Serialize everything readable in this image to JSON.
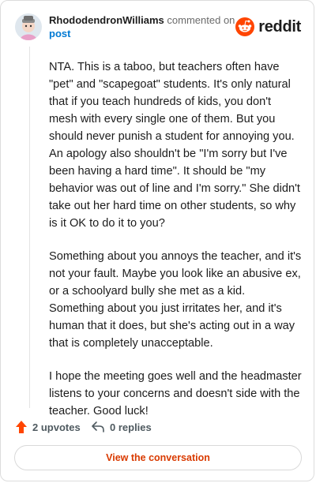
{
  "header": {
    "author": "RhododendronWilliams",
    "action_text": "commented on",
    "post_link": "post",
    "brand": "reddit"
  },
  "comment": {
    "paragraphs": [
      "NTA. This is a taboo, but teachers often have \"pet\" and \"scapegoat\" students. It's only natural that if you teach hundreds of kids, you don't mesh with every single one of them. But you should never punish a student for annoying you. An apology also shouldn't be \"I'm sorry but I've been having a hard time\". It should be \"my behavior was out of line and I'm sorry.\" She didn't take out her hard time on other students, so why is it OK to do it to you?",
      "Something about you annoys the teacher, and it's not your fault. Maybe you look like an abusive ex, or a schoolyard bully she met as a kid. Something about you just irritates her, and it's human that it does, but she's acting out in a way that is completely unacceptable.",
      "I hope the meeting goes well and the headmaster listens to your concerns and doesn't side with the teacher. Good luck!"
    ]
  },
  "footer": {
    "upvotes": "2 upvotes",
    "replies": "0 replies",
    "view_button": "View the conversation"
  },
  "colors": {
    "accent_orange": "#ff4500",
    "link_blue": "#0079d3",
    "button_text": "#d93a00"
  },
  "icons": {
    "avatar": "avatar-icon",
    "brand": "reddit-logo-icon",
    "upvote": "upvote-arrow-icon",
    "reply": "reply-arrow-icon"
  }
}
